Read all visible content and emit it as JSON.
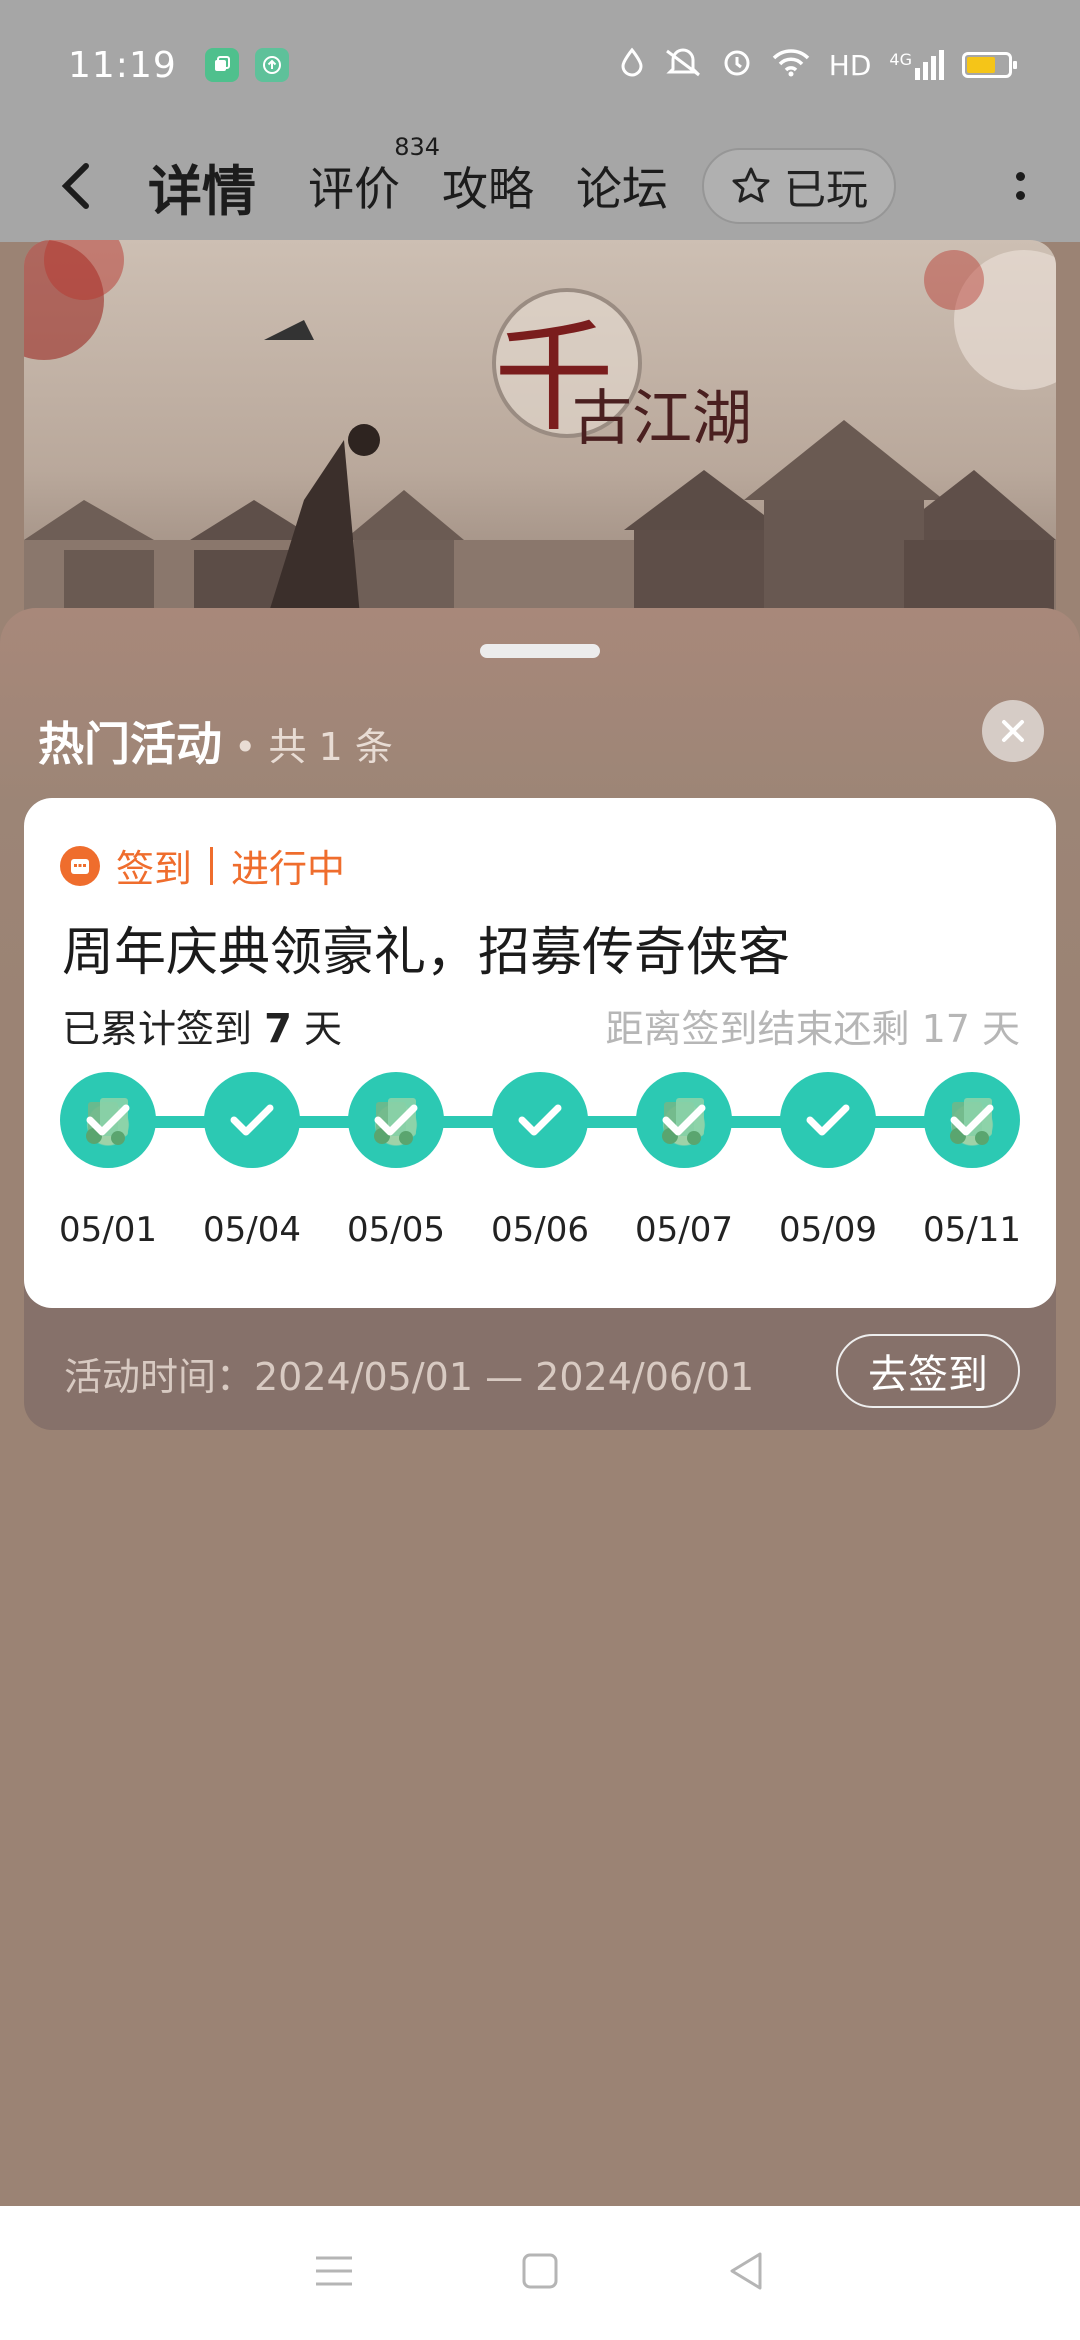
{
  "status_bar": {
    "time": "11:19",
    "network": "HD",
    "signal_label": "4G",
    "icons": [
      "app-icon-1",
      "app-icon-2",
      "drop-icon",
      "mute-icon",
      "alarm-icon",
      "wifi-icon",
      "signal-icon",
      "battery-icon"
    ]
  },
  "nav": {
    "tabs": [
      {
        "label": "详情",
        "active": true
      },
      {
        "label": "评价",
        "badge": "834"
      },
      {
        "label": "攻略"
      },
      {
        "label": "论坛"
      }
    ],
    "played_label": "已玩",
    "accent": "#1a9e8c"
  },
  "banner": {
    "logo_main": "千",
    "logo_sub": "古江湖"
  },
  "sheet": {
    "title": "热门活动",
    "count": "• 共 1 条"
  },
  "activity": {
    "tag": "签到",
    "status": "进行中",
    "title": "周年庆典领豪礼，招募传奇侠客",
    "signed_prefix": "已累计签到",
    "signed_days": "7",
    "signed_suffix": "天",
    "remaining": "距离签到结束还剩 17 天",
    "days": [
      {
        "date": "05/01",
        "reward": true
      },
      {
        "date": "05/04",
        "reward": false
      },
      {
        "date": "05/05",
        "reward": true
      },
      {
        "date": "05/06",
        "reward": false
      },
      {
        "date": "05/07",
        "reward": true
      },
      {
        "date": "05/09",
        "reward": false
      },
      {
        "date": "05/11",
        "reward": true
      }
    ],
    "period": "活动时间：2024/05/01 — 2024/06/01",
    "button": "去签到",
    "accent": "#ef6d2d",
    "track_color": "#2cc9b3"
  }
}
